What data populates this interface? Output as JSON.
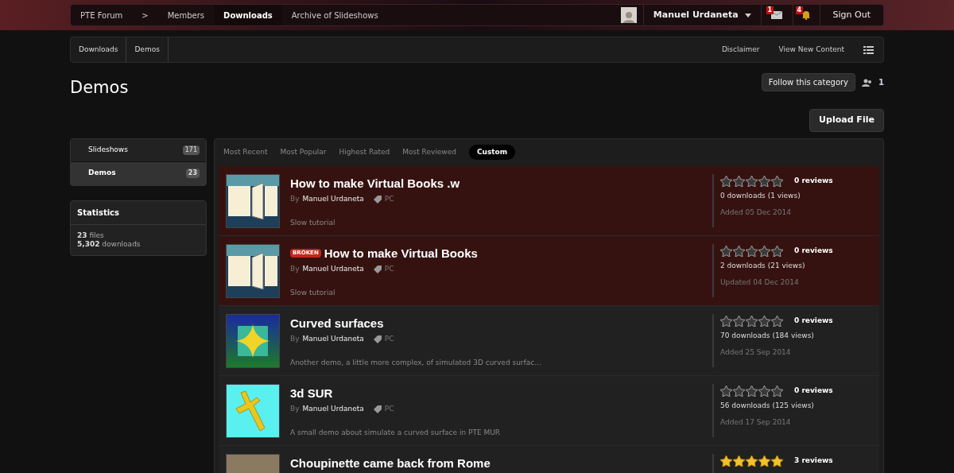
{
  "nav": {
    "items": [
      {
        "label": "PTE Forum",
        "selected": false
      },
      {
        "label": ">",
        "selected": false
      },
      {
        "label": "Members",
        "selected": false
      },
      {
        "label": "Downloads",
        "selected": true
      },
      {
        "label": "Archive of Slideshows",
        "selected": false
      }
    ],
    "user": "Manuel Urdaneta",
    "messages_count": "1",
    "notifications_count": "4",
    "sign_out": "Sign Out"
  },
  "breadcrumb": [
    "Downloads",
    "Demos"
  ],
  "subnav": [
    "Disclaimer",
    "View New Content"
  ],
  "page_title": "Demos",
  "follow": {
    "label": "Follow this category",
    "count": "1"
  },
  "upload_button": "Upload File",
  "categories": [
    {
      "label": "Slideshows",
      "count": "171",
      "selected": false
    },
    {
      "label": "Demos",
      "count": "23",
      "selected": true
    }
  ],
  "statistics": {
    "title": "Statistics",
    "lines": [
      "**23** files",
      "**5,302** downloads"
    ]
  },
  "sort_tabs": [
    {
      "label": "Most Recent",
      "selected": false
    },
    {
      "label": "Most Popular",
      "selected": false
    },
    {
      "label": "Highest Rated",
      "selected": false
    },
    {
      "label": "Most Reviewed",
      "selected": false
    },
    {
      "label": "Custom",
      "selected": true
    }
  ],
  "files": [
    {
      "kind": "book",
      "title": "How to make Virtual Books .w",
      "broken": false,
      "highlighted": true,
      "by": "By",
      "author": "Manuel Urdaneta",
      "tag": "PC",
      "description": "Slow tutorial",
      "stars": 0,
      "reviews": "0 reviews",
      "stats": "0 downloads (1 views)",
      "date": "Added 05 Dec 2014"
    },
    {
      "kind": "book",
      "title": "How to make Virtual Books",
      "broken": true,
      "badge": "BROKEN",
      "highlighted": true,
      "by": "By",
      "author": "Manuel Urdaneta",
      "tag": "PC",
      "description": "Slow tutorial",
      "stars": 0,
      "reviews": "0 reviews",
      "stats": "2 downloads (21 views)",
      "date": "Updated 04 Dec 2014"
    },
    {
      "kind": "diamond",
      "title": "Curved surfaces",
      "broken": false,
      "highlighted": false,
      "by": "By",
      "author": "Manuel Urdaneta",
      "tag": "PC",
      "description": "Another demo, a little more complex, of simulated 3D curved surfac...",
      "stars": 0,
      "reviews": "0 reviews",
      "stats": "70 downloads (184 views)",
      "date": "Added 25 Sep 2014"
    },
    {
      "kind": "cross",
      "title": "3d SUR",
      "broken": false,
      "highlighted": false,
      "by": "By",
      "author": "Manuel Urdaneta",
      "tag": "PC",
      "description": "A small demo about simulate a curved surface in PTE MUR",
      "stars": 0,
      "reviews": "0 reviews",
      "stats": "56 downloads (125 views)",
      "date": "Added 17 Sep 2014"
    },
    {
      "kind": "photo",
      "title": "Choupinette came back from Rome",
      "broken": false,
      "highlighted": false,
      "stars": 5,
      "reviews": "3 reviews"
    }
  ]
}
